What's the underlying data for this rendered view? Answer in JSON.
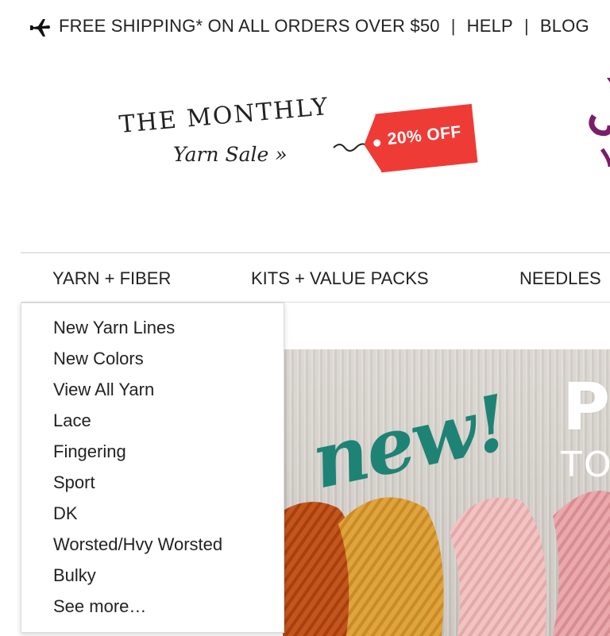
{
  "topbar": {
    "icon": "airplane-icon",
    "shipping_text": "FREE SHIPPING* ON ALL ORDERS OVER $50",
    "separator": "|",
    "help_link": "HELP",
    "blog_link": "BLOG"
  },
  "promo": {
    "line1": "THE MONTHLY",
    "line2": "Yarn Sale »",
    "tag_text": "20% OFF",
    "tag_color": "#ef3b36"
  },
  "nav": {
    "items": [
      {
        "label": "YARN + FIBER",
        "active": true
      },
      {
        "label": "KITS + VALUE PACKS",
        "active": false
      },
      {
        "label": "NEEDLES",
        "active": false
      }
    ]
  },
  "dropdown": {
    "items": [
      "New Yarn Lines",
      "New Colors",
      "View All Yarn",
      "Lace",
      "Fingering",
      "Sport",
      "DK",
      "Worsted/Hvy Worsted",
      "Bulky",
      "See more…"
    ]
  },
  "hero": {
    "script_text": "new!",
    "heading_partial": "PR",
    "subheading_partial": "TON",
    "accent_color": "#1e8374"
  }
}
